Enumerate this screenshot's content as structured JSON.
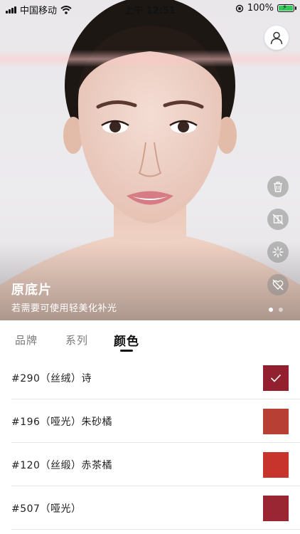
{
  "status_bar": {
    "carrier": "中国移动",
    "time": "上午 12:51",
    "battery_text": "100%",
    "battery_level": 1.0
  },
  "photo": {
    "title": "原底片",
    "subtitle": "若需要可使用轻美化补光",
    "page_count": 2,
    "current_page": 1
  },
  "tools": [
    {
      "icon": "trash-icon"
    },
    {
      "icon": "compare-off-icon"
    },
    {
      "icon": "sparkle-icon"
    },
    {
      "icon": "favorite-off-icon"
    }
  ],
  "tabs": [
    {
      "label": "品牌"
    },
    {
      "label": "系列"
    },
    {
      "label": "颜色",
      "active": true
    }
  ],
  "shades": [
    {
      "label": "#290（丝绒）诗",
      "color": "#93202e",
      "selected": true
    },
    {
      "label": "#196（哑光）朱砂橘",
      "color": "#b83f33",
      "selected": false
    },
    {
      "label": "#120（丝缎）赤茶橘",
      "color": "#c7342c",
      "selected": false
    },
    {
      "label": "#507（哑光）",
      "color": "#9a2533",
      "selected": false
    }
  ]
}
